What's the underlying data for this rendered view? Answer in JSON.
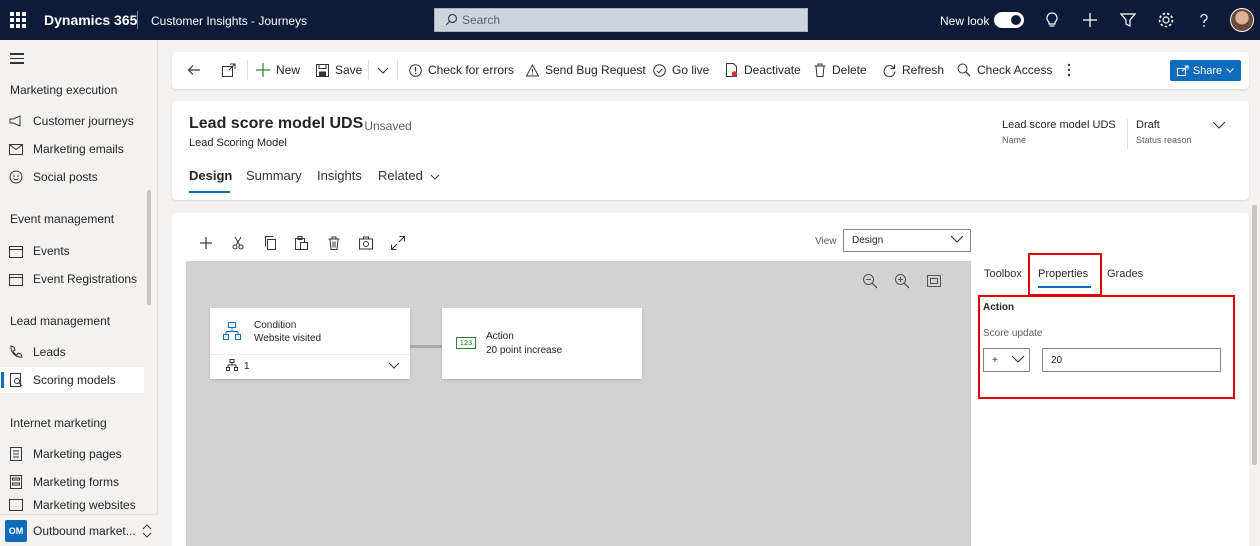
{
  "topbar": {
    "app_name": "Dynamics 365",
    "area_name": "Customer Insights - Journeys",
    "search_placeholder": "Search",
    "new_look_label": "New look"
  },
  "nav": {
    "sections": [
      {
        "title": "Marketing execution",
        "items": [
          {
            "label": "Customer journeys",
            "icon": "megaphone-icon"
          },
          {
            "label": "Marketing emails",
            "icon": "mail-icon"
          },
          {
            "label": "Social posts",
            "icon": "social-icon"
          }
        ]
      },
      {
        "title": "Event management",
        "items": [
          {
            "label": "Events",
            "icon": "calendar-icon"
          },
          {
            "label": "Event Registrations",
            "icon": "calendar-icon"
          }
        ]
      },
      {
        "title": "Lead management",
        "items": [
          {
            "label": "Leads",
            "icon": "phone-icon"
          },
          {
            "label": "Scoring models",
            "icon": "scoring-icon"
          }
        ]
      },
      {
        "title": "Internet marketing",
        "items": [
          {
            "label": "Marketing pages",
            "icon": "page-icon"
          },
          {
            "label": "Marketing forms",
            "icon": "form-icon"
          },
          {
            "label": "Marketing websites",
            "icon": "website-icon"
          }
        ]
      }
    ],
    "area_badge": "OM",
    "area_label": "Outbound market..."
  },
  "commands": {
    "new": "New",
    "save": "Save",
    "check_errors": "Check for errors",
    "send_bug": "Send Bug Request",
    "go_live": "Go live",
    "deactivate": "Deactivate",
    "delete": "Delete",
    "refresh": "Refresh",
    "check_access": "Check Access",
    "share": "Share"
  },
  "record": {
    "title": "Lead score model UDS",
    "unsaved": "- Unsaved",
    "entity": "Lead Scoring Model",
    "tabs": [
      "Design",
      "Summary",
      "Insights",
      "Related"
    ],
    "fields": [
      {
        "value": "Lead score model UDS",
        "label": "Name"
      },
      {
        "value": "Draft",
        "label": "Status reason"
      }
    ]
  },
  "designer": {
    "view_label": "View",
    "view_value": "Design",
    "condition": {
      "title": "Condition",
      "detail": "Website visited",
      "branch_count": "1"
    },
    "action": {
      "title": "Action",
      "detail": "20 point increase",
      "badge": "123"
    }
  },
  "panel": {
    "tabs": [
      "Toolbox",
      "Properties",
      "Grades"
    ],
    "section_title": "Action",
    "score_update_label": "Score update",
    "operator": "+",
    "value": "20"
  },
  "colors": {
    "topbar": "#0b1b38",
    "accent": "#0f6cbd",
    "highlight": "#e00000",
    "canvas": "#d2d2d2"
  }
}
